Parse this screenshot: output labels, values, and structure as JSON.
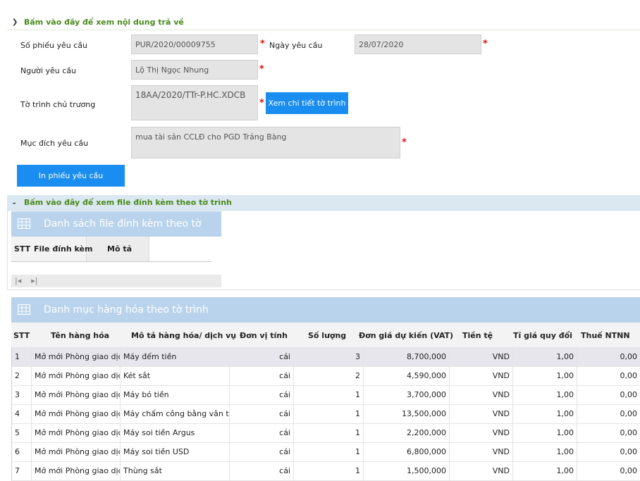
{
  "section_response": {
    "title": "Bấm vào đây để xem nội dung trả về"
  },
  "form": {
    "request_no_label": "Số phiếu yêu cầu",
    "request_no_value": "PUR/2020/00009755",
    "request_date_label": "Ngày yêu cầu",
    "request_date_value": "28/07/2020",
    "requester_label": "Người yêu cầu",
    "requester_value": "Lộ Thị Ngọc Nhung",
    "proposal_label": "Tờ trình chủ trương",
    "proposal_value": "18AA/2020/TTr-P.HC.XDCB",
    "proposal_detail_button": "Xem chi tiết tờ trình",
    "purpose_label": "Mục đích yêu cầu",
    "purpose_value": "mua tài sản CCLĐ cho PGD Trảng Bàng",
    "required_mark": "*",
    "print_button": "In phiếu yêu cầu"
  },
  "section_attachments": {
    "title": "Bấm vào đây để xem file đính kèm theo tờ trình"
  },
  "attachments_grid": {
    "title": "Danh sách file đính kèm theo tờ trình",
    "columns": [
      "STT",
      "File đính kèm",
      "Mô tả"
    ],
    "pager": {
      "first": "|◂",
      "next": "▸|"
    }
  },
  "items_grid": {
    "title": "Danh mục hàng hóa theo tờ trình",
    "columns": [
      "STT",
      "Tên hàng hóa",
      "Mô tả hàng hóa/ dịch vụ",
      "Đơn vị tính",
      "Số lượng",
      "Đơn giá dự kiến (VAT)",
      "Tiền tệ",
      "Tỉ giá quy đổi",
      "Thuế NTNN"
    ],
    "rows": [
      [
        "1",
        "Mở mới Phòng giao dịch",
        "Máy đếm tiền",
        "cái",
        "3",
        "8,700,000",
        "VND",
        "1,00",
        "0,00"
      ],
      [
        "2",
        "Mở mới Phòng giao dịch",
        "Két sắt",
        "cái",
        "2",
        "4,590,000",
        "VND",
        "1,00",
        "0,00"
      ],
      [
        "3",
        "Mở mới Phòng giao dịch",
        "Máy bó tiền",
        "cái",
        "1",
        "3,700,000",
        "VND",
        "1,00",
        "0,00"
      ],
      [
        "4",
        "Mở mới Phòng giao dịch",
        "Máy chấm công bằng vân tay",
        "cái",
        "1",
        "13,500,000",
        "VND",
        "1,00",
        "0,00"
      ],
      [
        "5",
        "Mở mới Phòng giao dịch",
        "Máy soi tiền Argus",
        "cái",
        "1",
        "2,200,000",
        "VND",
        "1,00",
        "0,00"
      ],
      [
        "6",
        "Mở mới Phòng giao dịch",
        "Máy soi tiền USD",
        "cái",
        "1",
        "6,800,000",
        "VND",
        "1,00",
        "0,00"
      ],
      [
        "7",
        "Mở mới Phòng giao dịch",
        "Thùng sắt",
        "cái",
        "1",
        "1,500,000",
        "VND",
        "1,00",
        "0,00"
      ]
    ]
  },
  "colors": {
    "section_title": "#4a8a1c",
    "button": "#1a8ef0",
    "grid_header": "#b9d3ec",
    "required": "#e01010"
  }
}
